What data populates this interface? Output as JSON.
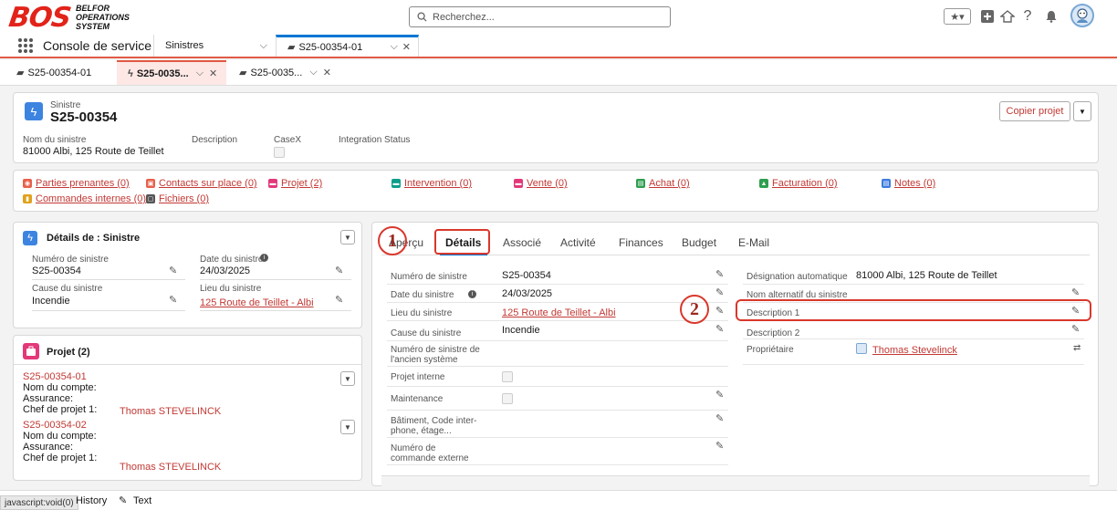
{
  "header": {
    "logo_text": "BOS",
    "logo_sub_line1": "BELFOR",
    "logo_sub_line2": "OPERATIONS",
    "logo_sub_line3": "SYSTEM",
    "search_placeholder": "Recherchez..."
  },
  "appnav": {
    "app_name": "Console de service",
    "tabs": [
      {
        "label": "Sinistres"
      },
      {
        "label": "S25-00354-01"
      }
    ]
  },
  "subtabs": [
    {
      "label": "S25-00354-01"
    },
    {
      "label": "S25-0035..."
    },
    {
      "label": "S25-0035..."
    }
  ],
  "record": {
    "object_label": "Sinistre",
    "title": "S25-00354",
    "copy_button": "Copier projet",
    "fields": [
      {
        "label": "Nom du sinistre",
        "value": "81000 Albi, 125 Route de Teillet"
      },
      {
        "label": "Description",
        "value": ""
      },
      {
        "label": "CaseX",
        "value": ""
      },
      {
        "label": "Integration Status",
        "value": ""
      }
    ]
  },
  "related_links": [
    {
      "label": "Parties prenantes (0)",
      "color": "#e8604c"
    },
    {
      "label": "Contacts sur place (0)",
      "color": "#e8604c"
    },
    {
      "label": "Projet (2)",
      "color": "#e3387a"
    },
    {
      "label": "Intervention (0)",
      "color": "#0d9e8a"
    },
    {
      "label": "Vente (0)",
      "color": "#e3387a"
    },
    {
      "label": "Achat (0)",
      "color": "#2e9e4f"
    },
    {
      "label": "Facturation (0)",
      "color": "#2e9e4f"
    },
    {
      "label": "Notes (0)",
      "color": "#3d7be0"
    },
    {
      "label": "Commandes internes (0)",
      "color": "#e0a21d"
    },
    {
      "label": "Fichiers (0)",
      "color": "#555555"
    }
  ],
  "details_card": {
    "title": "Détails de : Sinistre",
    "fields": [
      {
        "label": "Numéro de sinistre",
        "value": "S25-00354"
      },
      {
        "label": "Date du sinistre",
        "value": "24/03/2025"
      },
      {
        "label": "Cause du sinistre",
        "value": "Incendie"
      },
      {
        "label": "Lieu du sinistre",
        "value": "125 Route de Teillet - Albi"
      }
    ]
  },
  "projet_card": {
    "title": "Projet (2)",
    "items": [
      {
        "id": "S25-00354-01",
        "l1": "Nom du compte:",
        "l2": "Assurance:",
        "l3": "Chef de projet 1:",
        "chef": "Thomas STEVELINCK"
      },
      {
        "id": "S25-00354-02",
        "l1": "Nom du compte:",
        "l2": "Assurance:",
        "l3": "Chef de projet 1:",
        "chef": "Thomas STEVELINCK"
      }
    ]
  },
  "main_tabs": [
    {
      "label": "Aperçu"
    },
    {
      "label": "Détails"
    },
    {
      "label": "Associé"
    },
    {
      "label": "Activité"
    },
    {
      "label": "Finances"
    },
    {
      "label": "Budget"
    },
    {
      "label": "E-Mail"
    }
  ],
  "detail_left": [
    {
      "label": "Numéro de sinistre",
      "value": "S25-00354"
    },
    {
      "label": "Date du sinistre",
      "value": "24/03/2025"
    },
    {
      "label": "Lieu du sinistre",
      "value": "125 Route de Teillet - Albi"
    },
    {
      "label": "Cause du sinistre",
      "value": "Incendie"
    },
    {
      "label": "Numéro de sinistre de l'ancien système",
      "value": ""
    },
    {
      "label": "Projet interne",
      "value": ""
    },
    {
      "label": "Maintenance",
      "value": ""
    },
    {
      "label": "Bâtiment, Code inter-phone, étage...",
      "value": ""
    },
    {
      "label": "Numéro de commande externe",
      "value": ""
    }
  ],
  "detail_right": [
    {
      "label": "Désignation automatique",
      "value": "81000 Albi, 125 Route de Teillet"
    },
    {
      "label": "Nom alternatif du sinistre",
      "value": ""
    },
    {
      "label": "Description 1",
      "value": ""
    },
    {
      "label": "Description 2",
      "value": ""
    },
    {
      "label": "Propriétaire",
      "value": "Thomas Stevelinck"
    }
  ],
  "annotations": [
    "1",
    "2"
  ],
  "footer": {
    "status_url": "javascript:void(0)",
    "history": "History",
    "text": "Text"
  }
}
